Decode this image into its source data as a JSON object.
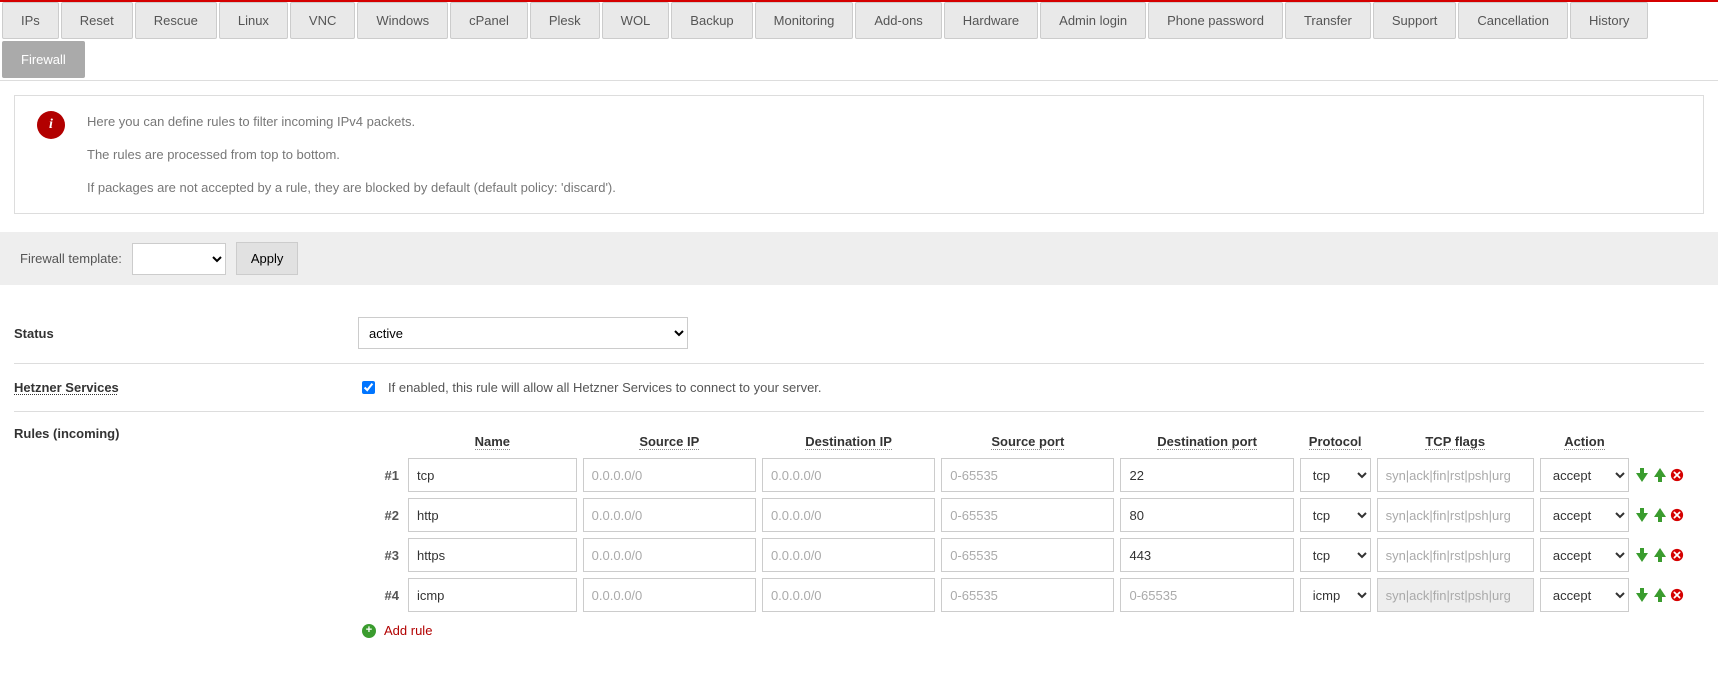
{
  "tabs": [
    "IPs",
    "Reset",
    "Rescue",
    "Linux",
    "VNC",
    "Windows",
    "cPanel",
    "Plesk",
    "WOL",
    "Backup",
    "Monitoring",
    "Add-ons",
    "Hardware",
    "Admin login",
    "Phone password",
    "Transfer",
    "Support",
    "Cancellation",
    "History",
    "Firewall"
  ],
  "active_tab": "Firewall",
  "info": {
    "line1": "Here you can define rules to filter incoming IPv4 packets.",
    "line2": "The rules are processed from top to bottom.",
    "line3": "If packages are not accepted by a rule, they are blocked by default (default policy: 'discard')."
  },
  "template_bar": {
    "label": "Firewall template:",
    "apply": "Apply"
  },
  "status": {
    "label": "Status",
    "value": "active"
  },
  "hetzner": {
    "label": "Hetzner Services",
    "checked": true,
    "desc": "If enabled, this rule will allow all Hetzner Services to connect to your server."
  },
  "rules_label": "Rules (incoming)",
  "headers": {
    "name": "Name",
    "source_ip": "Source IP",
    "dest_ip": "Destination IP",
    "source_port": "Source port",
    "dest_port": "Destination port",
    "protocol": "Protocol",
    "tcp_flags": "TCP flags",
    "action": "Action"
  },
  "placeholders": {
    "ip": "0.0.0.0/0",
    "port": "0-65535",
    "flags": "syn|ack|fin|rst|psh|urg"
  },
  "rules": [
    {
      "idx": "#1",
      "name": "tcp",
      "source_ip": "",
      "dest_ip": "",
      "source_port": "",
      "dest_port": "22",
      "protocol": "tcp",
      "flags": "",
      "flags_disabled": false,
      "action": "accept"
    },
    {
      "idx": "#2",
      "name": "http",
      "source_ip": "",
      "dest_ip": "",
      "source_port": "",
      "dest_port": "80",
      "protocol": "tcp",
      "flags": "",
      "flags_disabled": false,
      "action": "accept"
    },
    {
      "idx": "#3",
      "name": "https",
      "source_ip": "",
      "dest_ip": "",
      "source_port": "",
      "dest_port": "443",
      "protocol": "tcp",
      "flags": "",
      "flags_disabled": false,
      "action": "accept"
    },
    {
      "idx": "#4",
      "name": "icmp",
      "source_ip": "",
      "dest_ip": "",
      "source_port": "",
      "dest_port": "",
      "protocol": "icmp",
      "flags": "",
      "flags_disabled": true,
      "action": "accept"
    }
  ],
  "add_rule": "Add rule"
}
